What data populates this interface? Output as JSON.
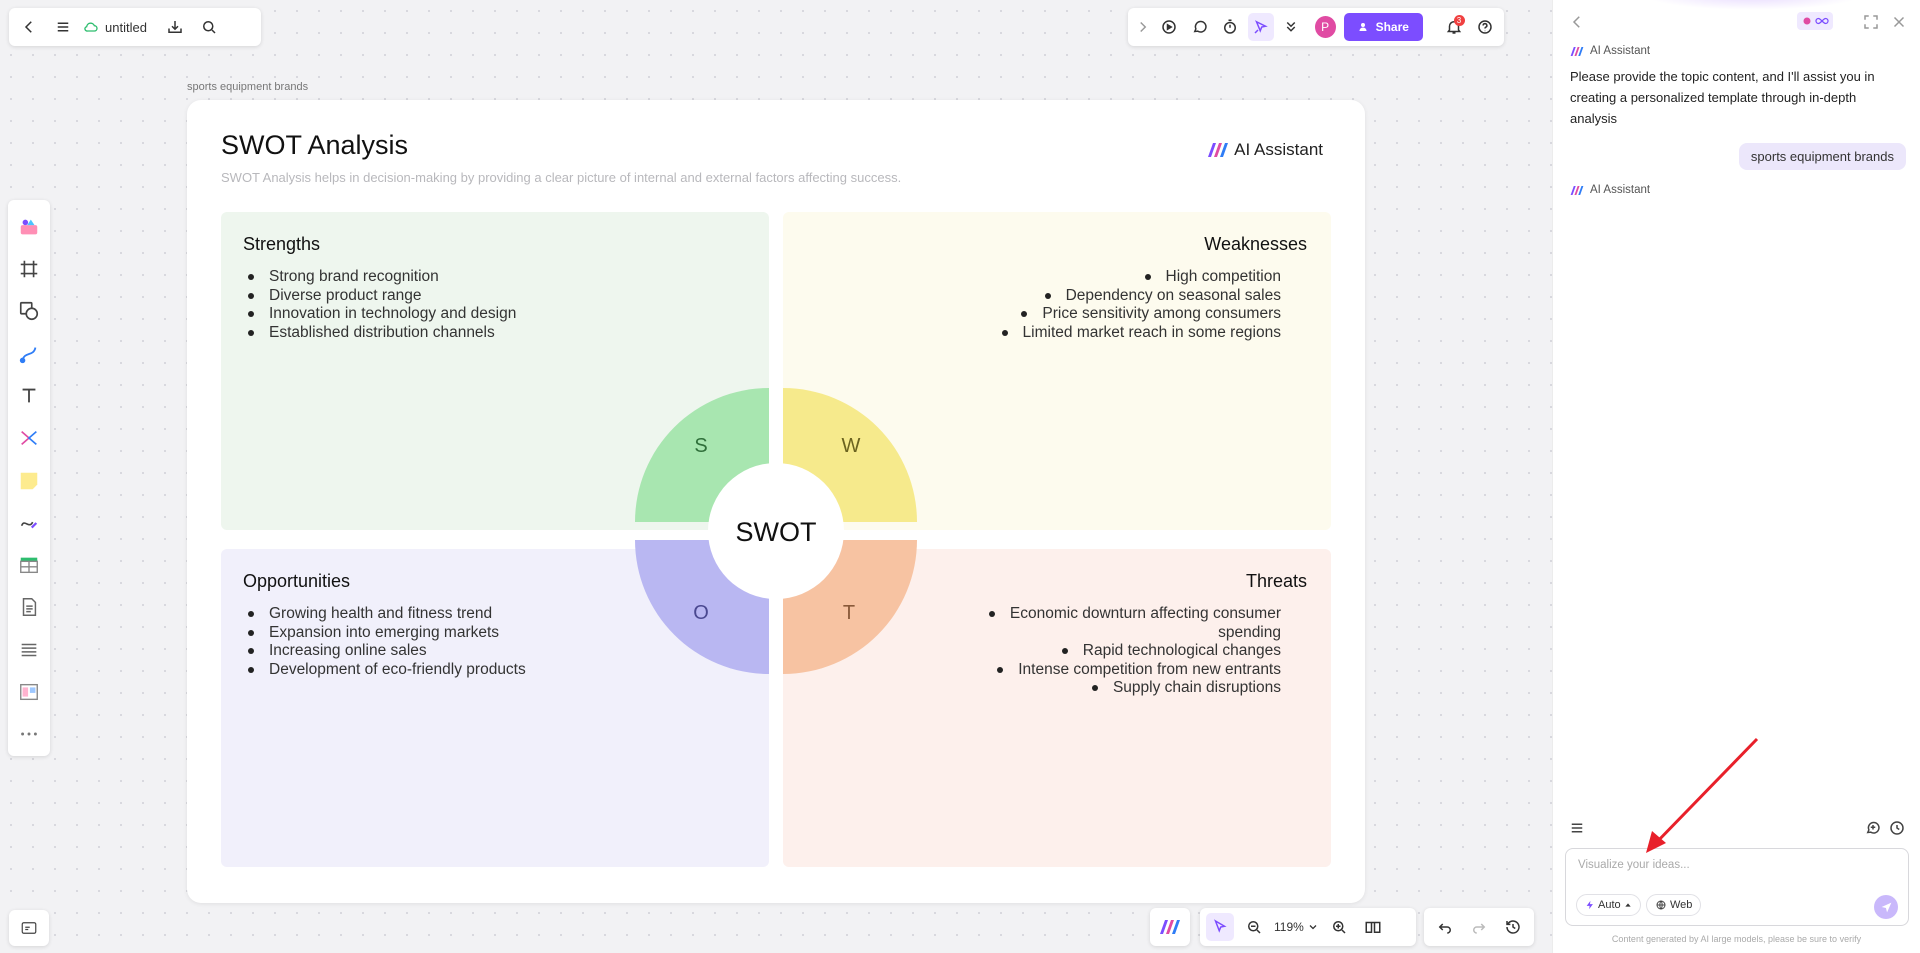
{
  "topbar": {
    "doc_title": "untitled"
  },
  "toolbar_right": {
    "share_label": "Share",
    "avatar_letter": "P",
    "notification_count": "3"
  },
  "canvas": {
    "frame_label": "sports equipment brands",
    "title": "SWOT Analysis",
    "subtitle": "SWOT Analysis helps in decision-making by providing a clear picture of internal and external factors affecting success.",
    "brand_label": "AI Assistant",
    "center_label": "SWOT",
    "quadrants": {
      "strengths": {
        "title": "Strengths",
        "letter": "S",
        "items": [
          "Strong brand recognition",
          "Diverse product range",
          "Innovation in technology and design",
          "Established distribution channels"
        ]
      },
      "weaknesses": {
        "title": "Weaknesses",
        "letter": "W",
        "items": [
          "High competition",
          "Dependency on seasonal sales",
          "Price sensitivity among consumers",
          "Limited market reach in some regions"
        ]
      },
      "opportunities": {
        "title": "Opportunities",
        "letter": "O",
        "items": [
          "Growing health and fitness trend",
          "Expansion into emerging markets",
          "Increasing online sales",
          "Development of eco-friendly products"
        ]
      },
      "threats": {
        "title": "Threats",
        "letter": "T",
        "items": [
          "Economic downturn affecting consumer spending",
          "Rapid technological changes",
          "Intense competition from new entrants",
          "Supply chain disruptions"
        ]
      }
    }
  },
  "bottom_toolbar": {
    "zoom_level": "119%"
  },
  "ai_panel": {
    "assistant_name": "AI Assistant",
    "assistant_message": "Please provide the topic content, and I'll assist you in creating a personalized template through in-depth analysis",
    "user_message": "sports equipment brands",
    "input_placeholder": "Visualize your ideas...",
    "mode_chip": "Auto",
    "web_chip": "Web",
    "disclaimer": "Content generated by AI large models, please be sure to verify"
  },
  "colors": {
    "accent": "#7c4dff",
    "strengths_wedge": "#a8e6b0",
    "weaknesses_wedge": "#f6ea8c",
    "opportunities_wedge": "#b9b7f2",
    "threats_wedge": "#f7c3a2",
    "arrow": "#e8202a"
  }
}
